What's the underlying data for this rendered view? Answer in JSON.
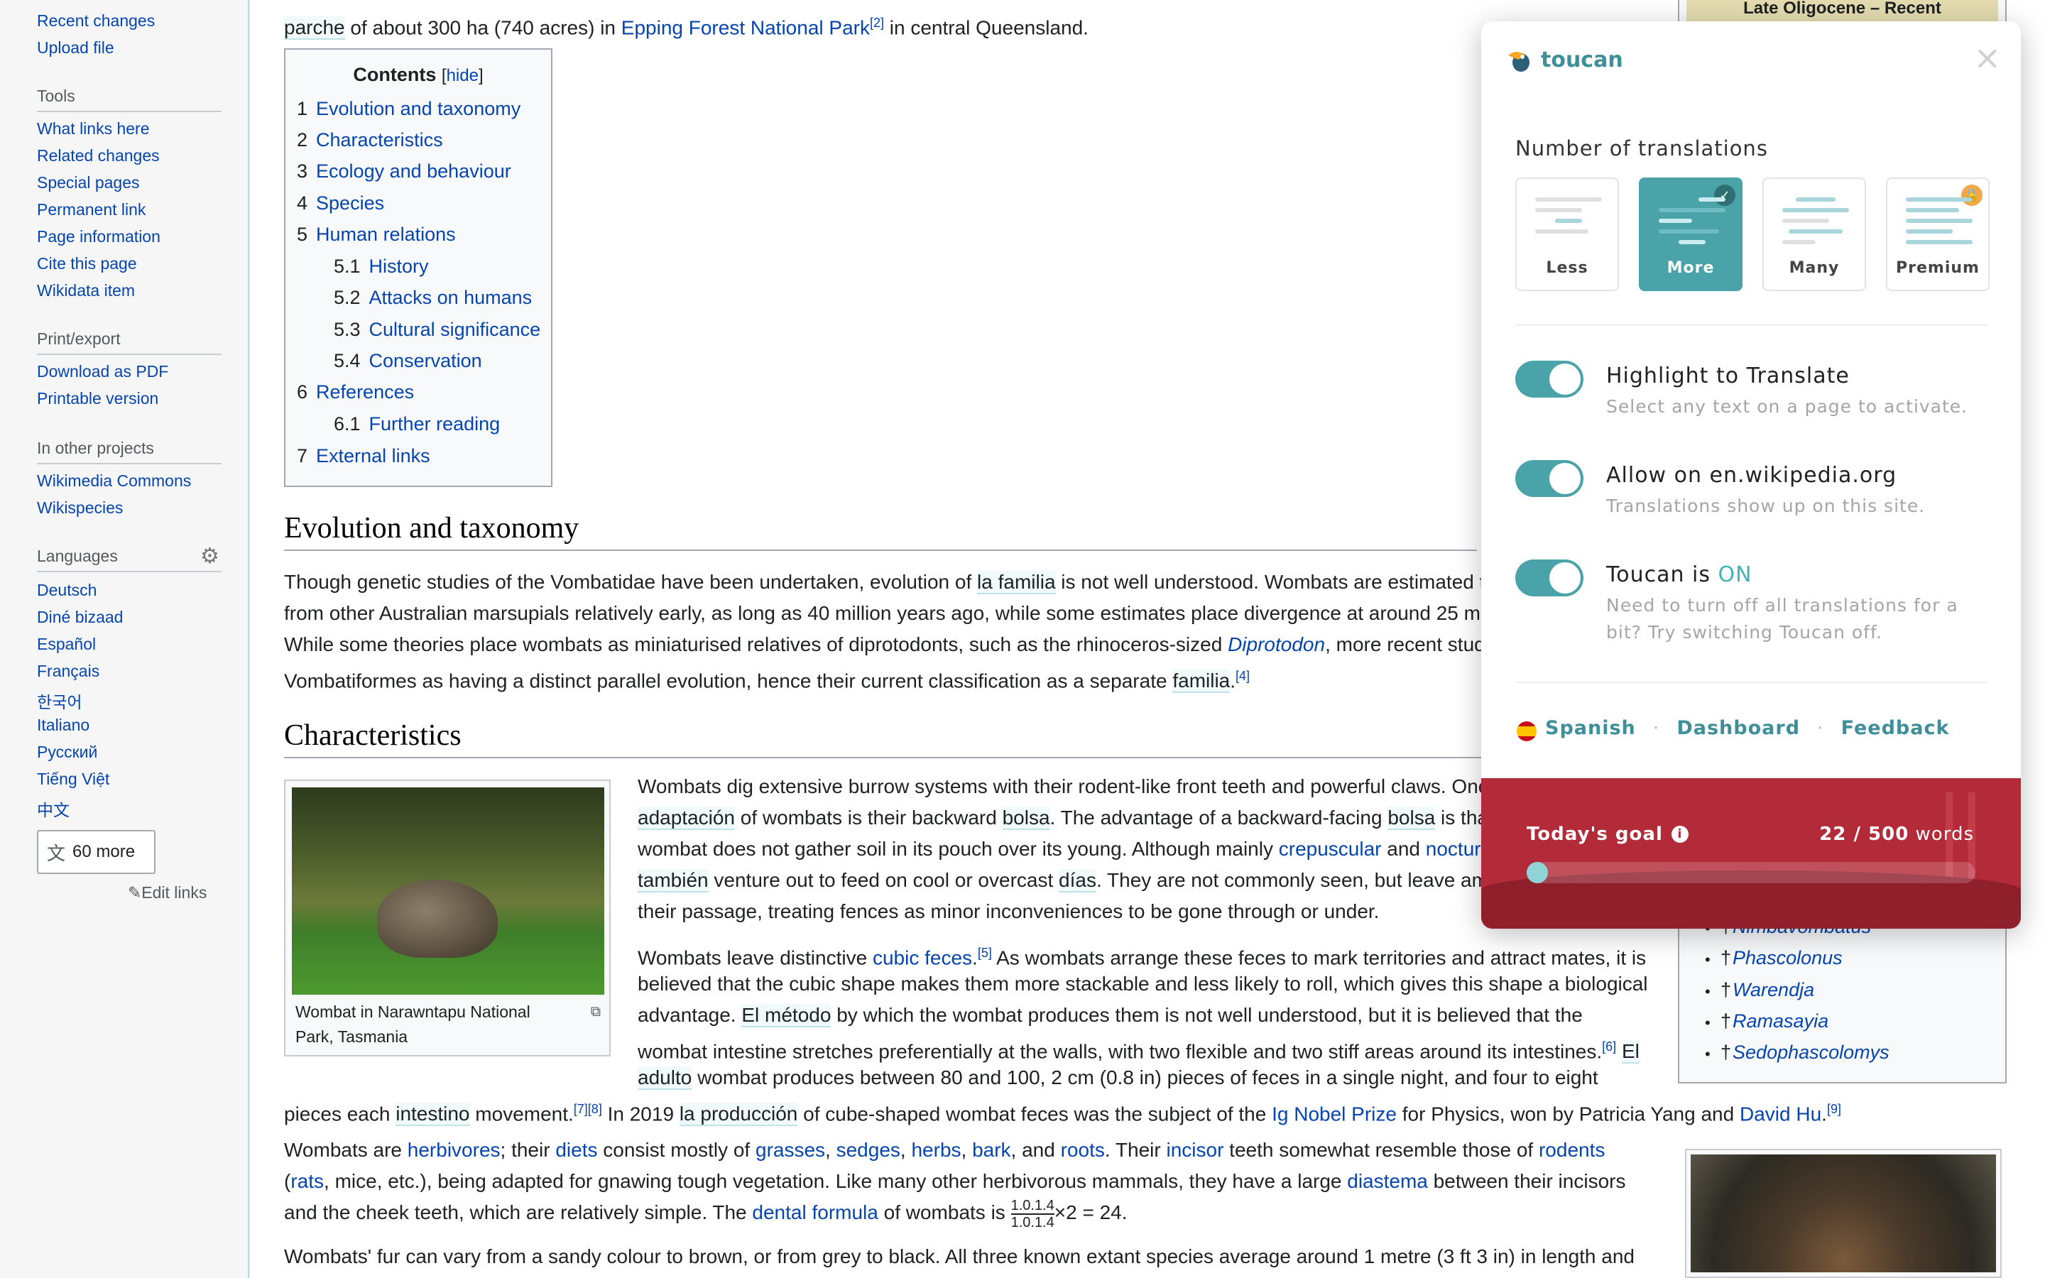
{
  "sidebar": {
    "top_links": [
      "Recent changes",
      "Upload file"
    ],
    "tools_heading": "Tools",
    "tools": [
      "What links here",
      "Related changes",
      "Special pages",
      "Permanent link",
      "Page information",
      "Cite this page",
      "Wikidata item"
    ],
    "print_heading": "Print/export",
    "print": [
      "Download as PDF",
      "Printable version"
    ],
    "projects_heading": "In other projects",
    "projects": [
      "Wikimedia Commons",
      "Wikispecies"
    ],
    "languages_heading": "Languages",
    "languages": [
      "Deutsch",
      "Diné bizaad",
      "Español",
      "Français",
      "한국어",
      "Italiano",
      "Русский",
      "Tiếng Việt",
      "中文"
    ],
    "more_languages": "60 more",
    "edit_links": "Edit links"
  },
  "intro": {
    "pre": "parche",
    "mid": " of about 300 ha (740 acres) in ",
    "link": "Epping Forest National Park",
    "ref": "[2]",
    "post": " in central Queensland."
  },
  "toc": {
    "title": "Contents",
    "hide": "hide",
    "items": [
      {
        "n": "1",
        "t": "Evolution and taxonomy"
      },
      {
        "n": "2",
        "t": "Characteristics"
      },
      {
        "n": "3",
        "t": "Ecology and behaviour"
      },
      {
        "n": "4",
        "t": "Species"
      },
      {
        "n": "5",
        "t": "Human relations"
      },
      {
        "n": "5.1",
        "t": "History"
      },
      {
        "n": "5.2",
        "t": "Attacks on humans"
      },
      {
        "n": "5.3",
        "t": "Cultural significance"
      },
      {
        "n": "5.4",
        "t": "Conservation"
      },
      {
        "n": "6",
        "t": "References"
      },
      {
        "n": "6.1",
        "t": "Further reading"
      },
      {
        "n": "7",
        "t": "External links"
      }
    ]
  },
  "sections": {
    "evolution": "Evolution and taxonomy",
    "characteristics": "Characteristics"
  },
  "evolution_text": {
    "l1a": "Though genetic studies of the Vombatidae have been undertaken, evolution of ",
    "l1hl": "la familia",
    "l1b": " is not well understood. Wombats are estimated t",
    "l2": "from other Australian marsupials relatively early, as long as 40 million years ago, while some estimates place divergence at around 25 m",
    "l3a": "While some theories place wombats as miniaturised relatives of diprotodonts, such as the rhinoceros-sized ",
    "l3link": "Diprotodon",
    "l3b": ", more recent stud",
    "l4a": "Vombatiformes as having a distinct parallel evolution, hence their current classification as a separate ",
    "l4hl": "familia",
    "l4b": ".",
    "l4ref": "[4]"
  },
  "thumb": {
    "caption": "Wombat in Narawntapu National Park, Tasmania"
  },
  "char_text": {
    "l1": "Wombats dig extensive burrow systems with their rodent-like front teeth and powerful claws. One",
    "l2hl1": "adaptación",
    "l2a": " of wombats is their backward ",
    "l2hl2": "bolsa",
    "l2b": ". The advantage of a backward-facing ",
    "l2hl3": "bolsa",
    "l2c": " is tha",
    "l3a": "wombat does not gather soil in its pouch over its young. Although mainly ",
    "l3link": "crepuscular",
    "l3b": " and ",
    "l3link2": "noctur",
    "l4hl": "también",
    "l4a": " venture out to feed on cool or overcast ",
    "l4hl2": "días",
    "l4b": ". They are not commonly seen, but leave am",
    "l5": "their passage, treating fences as minor inconveniences to be gone through or under.",
    "p2l1a": "Wombats leave distinctive ",
    "p2l1link": "cubic feces",
    "p2l1ref": "[5]",
    "p2l1b": " As wombats arrange these feces to mark territories and attract mates, it is",
    "p2l2": "believed that the cubic shape makes them more stackable and less likely to roll, which gives this shape a biological",
    "p2l3a": "advantage. ",
    "p2l3hl": "El método",
    "p2l3b": " by which the wombat produces them is not well understood, but it is believed that the",
    "p2l4a": "wombat intestine stretches preferentially at the walls, with two flexible and two stiff areas around its intestines.",
    "p2l4ref": "[6]",
    "p2l4hl": "El",
    "p2l5hl": "adulto",
    "p2l5": " wombat produces between 80 and 100, 2 cm (0.8 in) pieces of feces in a single night, and four to eight",
    "p2l6a": "pieces each ",
    "p2l6hl": "intestino",
    "p2l6b": " movement.",
    "p2l6ref": "[7][8]",
    "p2l6c": " In 2019 ",
    "p2l6hl2": "la producción",
    "p2l6d": " of cube-shaped wombat feces was the subject of the ",
    "p2l6link": "Ig Nobel Prize",
    "p2l6e": " for Physics, won by Patricia Yang and ",
    "p2l6link2": "David Hu",
    "p2l6ref2": "[9]",
    "p3l1a": "Wombats are ",
    "p3l1k1": "herbivores",
    "p3l1b": "; their ",
    "p3l1k2": "diets",
    "p3l1c": " consist mostly of ",
    "p3l1k3": "grasses",
    "p3l1k4": "sedges",
    "p3l1k5": "herbs",
    "p3l1k6": "bark",
    "p3l1k7": "roots",
    "p3l1d": ". Their ",
    "p3l1k8": "incisor",
    "p3l1e": " teeth somewhat resemble those of ",
    "p3l1k9": "rodents",
    "p3l2k": "rats",
    "p3l2a": ", mice, etc.), being adapted for gnawing tough vegetation. Like many other herbivorous mammals, they have a large ",
    "p3l2k2": "diastema",
    "p3l2b": " between their incisors",
    "p3l3a": "and the cheek teeth, which are relatively simple. The ",
    "p3l3k": "dental formula",
    "p3l3b": " of wombats is ",
    "p3l3frac_top": "1.0.1.4",
    "p3l3frac_bot": "1.0.1.4",
    "p3l3c": "×2 = 24.",
    "p4": "Wombats' fur can vary from a sandy colour to brown, or from grey to black. All three known extant species average around 1 metre (3 ft 3 in) in length and"
  },
  "infobox": {
    "band": "Late Oligocene – Recent",
    "taxa": [
      "Nimbavombatus",
      "Phascolonus",
      "Warendja",
      "Ramasayia",
      "Sedophascolomys"
    ],
    "dagger": "†"
  },
  "toucan": {
    "brand": "toucan",
    "close": "×",
    "num_title": "Number of translations",
    "options": [
      {
        "label": "Less"
      },
      {
        "label": "More"
      },
      {
        "label": "Many"
      },
      {
        "label": "Premium"
      }
    ],
    "toggles": [
      {
        "title": "Highlight to Translate",
        "sub1": "Select any text on a page to activate.",
        "sub2": ""
      },
      {
        "title": "Allow on en.wikipedia.org",
        "sub1": "Translations show up on this site.",
        "sub2": ""
      },
      {
        "title": "Toucan is ",
        "state": "ON",
        "sub1": "Need to turn off all translations for a",
        "sub2": "bit? Try switching Toucan off."
      }
    ],
    "footer": {
      "language": "Spanish",
      "dashboard": "Dashboard",
      "feedback": "Feedback",
      "sep": "·"
    },
    "goal": {
      "label": "Today's goal",
      "current": "22",
      "total": " / 500",
      "unit": " words",
      "progress": 0.044
    },
    "colors": {
      "accent": "#4aa3a8",
      "goal_bg": "#b32a38"
    }
  }
}
